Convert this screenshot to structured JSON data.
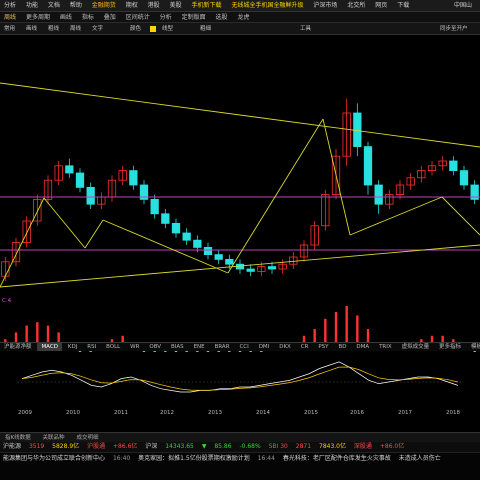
{
  "menu": {
    "items": [
      "分析",
      "功能",
      "文档",
      "帮助",
      "金融期货",
      "期权",
      "港股",
      "美股",
      "手机新下载",
      "无线城全手机国全融鲜升级",
      "沪深市场",
      "北交所",
      "网页",
      "下载"
    ],
    "right": "中国山"
  },
  "tabs": {
    "items": [
      "周线",
      "更多周期",
      "画线",
      "指标",
      "叠加",
      "区间统计",
      "分析",
      "定制版面",
      "选股",
      "龙虎"
    ],
    "active_index": 0
  },
  "toolbar": {
    "items": [
      "常用",
      "画线",
      "粗线",
      "周线",
      "文字",
      "工具"
    ],
    "color_label": "颜色",
    "linetype_label": "线型",
    "thickness_label": "粗细",
    "right_label": "同步至开户"
  },
  "indicator": {
    "macd_label": "C.4",
    "tabs": [
      "沪能源净额",
      "MACD",
      "KDJ",
      "RSI",
      "BOLL",
      "WR",
      "OBV",
      "BIAS",
      "ENE",
      "BRAR",
      "CCI",
      "DMI",
      "DKX",
      "CR",
      "PSY",
      "BD",
      "DMA",
      "TRIX",
      "虚拟成交量",
      "更多指标",
      "模板"
    ],
    "active_index": 1
  },
  "xaxis": {
    "years": [
      "2009",
      "2010",
      "2011",
      "2012",
      "2013",
      "2014",
      "2015",
      "2016",
      "2017",
      "2018"
    ]
  },
  "bottom_tabs": [
    "指K线数据",
    "关联品种",
    "成交明细"
  ],
  "quotes": [
    {
      "text": "沪能源",
      "color": "#c8c8c8"
    },
    {
      "text": "3519",
      "color": "#ff4a4a"
    },
    {
      "text": "5828.9亿",
      "color": "#ffd400"
    },
    {
      "text": "沪股通",
      "color": "#ff4a4a"
    },
    {
      "text": "+86.6亿",
      "color": "#ff4a4a"
    },
    {
      "text": "沪深",
      "color": "#c8c8c8"
    },
    {
      "text": "14343.65",
      "color": "#3cd03c"
    },
    {
      "text": "▼",
      "color": "#3cd03c"
    },
    {
      "text": "85.86",
      "color": "#3cd03c"
    },
    {
      "text": "-0.68%",
      "color": "#3cd03c"
    },
    {
      "text": "SBI 30",
      "color": "#ff4a4a"
    },
    {
      "text": "2871",
      "color": "#ff4a4a"
    },
    {
      "text": "7843.0亿",
      "color": "#ffd400"
    },
    {
      "text": "深股通",
      "color": "#ff4a4a"
    },
    {
      "text": "+86.0亿",
      "color": "#ff4a4a"
    }
  ],
  "news": [
    {
      "time": "",
      "text": "能源集团与华为公司成立联合创新中心"
    },
    {
      "time": "16:40",
      "text": "奥克家园：拟推1.5亿份股票期权激励计划"
    },
    {
      "time": "16:44",
      "text": "春光科技：老厂区配件仓库发生火灾事故"
    },
    {
      "time": "",
      "text": "未造成人员伤亡"
    }
  ],
  "colors": {
    "up": "#ff3030",
    "down": "#28e0e0",
    "trendline": "#d8d82a",
    "channel": "#c040c0",
    "macd_dif": "#ffffff",
    "macd_dea": "#ffcc00",
    "bg": "#000000"
  },
  "chart_data": {
    "type": "candlestick",
    "title": "",
    "xlabel": "",
    "ylabel": "",
    "x": [
      "2009",
      "2010",
      "2011",
      "2012",
      "2013",
      "2014",
      "2015",
      "2016",
      "2017",
      "2018"
    ],
    "candles": [
      [
        0.12,
        0.18,
        0.1,
        0.2
      ],
      [
        0.18,
        0.26,
        0.16,
        0.28
      ],
      [
        0.26,
        0.35,
        0.24,
        0.37
      ],
      [
        0.35,
        0.44,
        0.33,
        0.46
      ],
      [
        0.44,
        0.52,
        0.42,
        0.54
      ],
      [
        0.52,
        0.58,
        0.5,
        0.6
      ],
      [
        0.58,
        0.55,
        0.53,
        0.61
      ],
      [
        0.55,
        0.49,
        0.47,
        0.57
      ],
      [
        0.49,
        0.42,
        0.4,
        0.51
      ],
      [
        0.42,
        0.45,
        0.4,
        0.47
      ],
      [
        0.45,
        0.52,
        0.43,
        0.54
      ],
      [
        0.52,
        0.56,
        0.5,
        0.58
      ],
      [
        0.56,
        0.5,
        0.48,
        0.58
      ],
      [
        0.5,
        0.44,
        0.42,
        0.52
      ],
      [
        0.44,
        0.38,
        0.36,
        0.46
      ],
      [
        0.38,
        0.34,
        0.32,
        0.4
      ],
      [
        0.34,
        0.3,
        0.28,
        0.36
      ],
      [
        0.3,
        0.27,
        0.25,
        0.32
      ],
      [
        0.27,
        0.24,
        0.22,
        0.29
      ],
      [
        0.24,
        0.21,
        0.19,
        0.26
      ],
      [
        0.21,
        0.19,
        0.17,
        0.23
      ],
      [
        0.19,
        0.17,
        0.15,
        0.21
      ],
      [
        0.17,
        0.15,
        0.13,
        0.19
      ],
      [
        0.15,
        0.14,
        0.12,
        0.17
      ],
      [
        0.14,
        0.16,
        0.12,
        0.18
      ],
      [
        0.16,
        0.15,
        0.13,
        0.18
      ],
      [
        0.15,
        0.17,
        0.13,
        0.19
      ],
      [
        0.17,
        0.2,
        0.15,
        0.22
      ],
      [
        0.2,
        0.25,
        0.18,
        0.27
      ],
      [
        0.25,
        0.33,
        0.23,
        0.35
      ],
      [
        0.33,
        0.46,
        0.31,
        0.48
      ],
      [
        0.46,
        0.62,
        0.44,
        0.65
      ],
      [
        0.62,
        0.8,
        0.58,
        0.86
      ],
      [
        0.8,
        0.66,
        0.62,
        0.84
      ],
      [
        0.66,
        0.5,
        0.46,
        0.68
      ],
      [
        0.5,
        0.42,
        0.38,
        0.52
      ],
      [
        0.42,
        0.46,
        0.4,
        0.48
      ],
      [
        0.46,
        0.5,
        0.44,
        0.52
      ],
      [
        0.5,
        0.53,
        0.48,
        0.55
      ],
      [
        0.53,
        0.56,
        0.51,
        0.58
      ],
      [
        0.56,
        0.58,
        0.54,
        0.6
      ],
      [
        0.58,
        0.6,
        0.56,
        0.62
      ],
      [
        0.6,
        0.56,
        0.54,
        0.62
      ],
      [
        0.56,
        0.5,
        0.48,
        0.58
      ],
      [
        0.5,
        0.44,
        0.42,
        0.52
      ]
    ],
    "macd": [
      0.2,
      0.4,
      0.6,
      0.7,
      0.6,
      0.4,
      0.1,
      -0.2,
      -0.3,
      -0.1,
      0.2,
      0.3,
      0.1,
      -0.2,
      -0.4,
      -0.5,
      -0.6,
      -0.6,
      -0.5,
      -0.5,
      -0.4,
      -0.4,
      -0.3,
      -0.3,
      -0.2,
      -0.1,
      0.0,
      0.1,
      0.3,
      0.5,
      0.8,
      1.0,
      1.2,
      0.9,
      0.5,
      0.1,
      -0.1,
      0.0,
      0.1,
      0.2,
      0.3,
      0.3,
      0.2,
      0.0,
      -0.2
    ]
  }
}
